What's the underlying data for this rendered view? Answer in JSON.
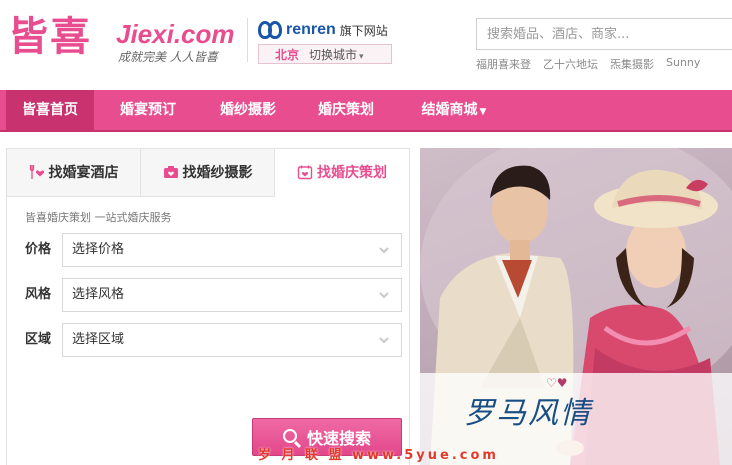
{
  "header": {
    "logo_cn": "皆喜",
    "logo_en": "Jiexi.com",
    "slogan": "成就完美 人人皆喜",
    "partner_name": "renren",
    "partner_suffix": "旗下网站",
    "city": "北京",
    "switch_city": "切换城市",
    "search_placeholder": "搜索婚品、酒店、商家...",
    "hot_keywords": [
      "福朋喜来登",
      "乙十六地坛",
      "炁集摄影",
      "Sunny"
    ]
  },
  "nav": {
    "items": [
      {
        "label": "皆喜首页"
      },
      {
        "label": "婚宴预订"
      },
      {
        "label": "婚纱摄影"
      },
      {
        "label": "婚庆策划"
      },
      {
        "label": "结婚商城"
      }
    ]
  },
  "panel": {
    "tabs": [
      {
        "label": "找婚宴酒店",
        "icon": "fork-knife-heart-icon"
      },
      {
        "label": "找婚纱摄影",
        "icon": "camera-heart-icon"
      },
      {
        "label": "找婚庆策划",
        "icon": "calendar-heart-icon"
      }
    ],
    "active_tab": 2,
    "description": "皆喜婚庆策划 一站式婚庆服务",
    "fields": [
      {
        "label": "价格",
        "value": "选择价格"
      },
      {
        "label": "风格",
        "value": "选择风格"
      },
      {
        "label": "区域",
        "value": "选择区域"
      }
    ],
    "submit": "快速搜索"
  },
  "banner": {
    "title": "罗马风情"
  },
  "watermark": "岁 月 联 盟  www.5yue.com",
  "colors": {
    "brand_pink": "#e84e8f",
    "nav_active": "#c8326f",
    "partner_blue": "#1a56a8"
  }
}
